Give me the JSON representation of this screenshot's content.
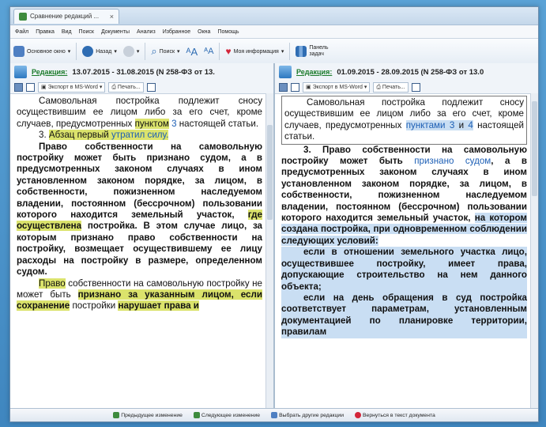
{
  "window": {
    "tab_title": "Сравнение редакций ...",
    "tab_close": "×"
  },
  "menu": [
    "Файл",
    "Правка",
    "Вид",
    "Поиск",
    "Документы",
    "Анализ",
    "Избранное",
    "Окна",
    "Помощь"
  ],
  "toolbar": {
    "main_window": "Основное окно",
    "back": "Назад",
    "search": "Поиск",
    "my_info": "Моя информация",
    "control_panel": "Панель задач"
  },
  "left": {
    "edition_label": "Редакция:",
    "edition_range": "13.07.2015 - 31.08.2015 (N 258-ФЗ от 13.",
    "export": "Экспорт в MS-Word",
    "print": "Печать..."
  },
  "right": {
    "edition_label": "Редакция:",
    "edition_range": "01.09.2015 - 28.09.2015 (N 258-ФЗ от 13.0",
    "export": "Экспорт в MS-Word",
    "print": "Печать..."
  },
  "left_text": {
    "p1a": "Самовольная постройка подлежит сносу осуществившим ее лицом либо за его счет, кроме случаев, предусмотренных ",
    "p1_hl": "пунктом",
    "p1_link": " 3",
    "p1b": " настоящей статьи.",
    "p2_num": "3. ",
    "p2_hl1": "Абзац первый",
    "p2_hl2": " утратил силу.",
    "p3a": "Право собственности на самовольную постройку может быть признано судом, а в предусмотренных законом случаях в ином установленном законом порядке, за лицом, в собственности, пожизненном наследуемом владении, постоянном (бессрочном) пользовании которого находится земельный участок, ",
    "p3_hl": "где осуществлена",
    "p3b": " постройка. В этом случае лицо, за которым признано право собственности на постройку, возмещает осуществившему ее лицу расходы на постройку в размере, определенном судом.",
    "p4_hl": "Право",
    "p4a": " собственности на самовольную постройку не может быть ",
    "p4_hl2": "признано за указанным лицом, если сохранение",
    "p4b": " постройки ",
    "p4_hl3": "нарушает права и"
  },
  "right_text": {
    "p1a": "Самовольная постройка подлежит сносу осуществившим ее лицом либо за его счет, кроме случаев, предусмотренных ",
    "p1_hl": "пунктами",
    "p1_link1": " 3",
    "p1_and": " и",
    "p1_link2": " 4",
    "p1b": " настоящей статьи.",
    "p2a": "3. Право собственности на самовольную постройку может быть ",
    "p2_link": "признано судом",
    "p2b": ", а в предусмотренных законом случаях в ином установленном законом порядке, за лицом, в собственности, пожизненном наследуемом владении, постоянном (бессрочном) пользовании которого находится земельный участок, ",
    "p2_hl": "на котором создана постройка, при одновременном соблюдении следующих условий:",
    "p3": "если в отношении земельного участка лицо, осуществившее постройку, имеет права, допускающие строительство на нем данного объекта;",
    "p4": "если на день обращения в суд постройка соответствует параметрам, установленным документацией по планировке территории, правилам"
  },
  "status": {
    "prev": "Предыдущее изменение",
    "next": "Следующее изменение",
    "choose": "Выбрать другие редакции",
    "back_doc": "Вернуться в текст документа"
  },
  "colors": {
    "highlight_yellow": "#dbe36c",
    "highlight_blue": "#c9def3",
    "edition_green": "#1a7a2a"
  }
}
